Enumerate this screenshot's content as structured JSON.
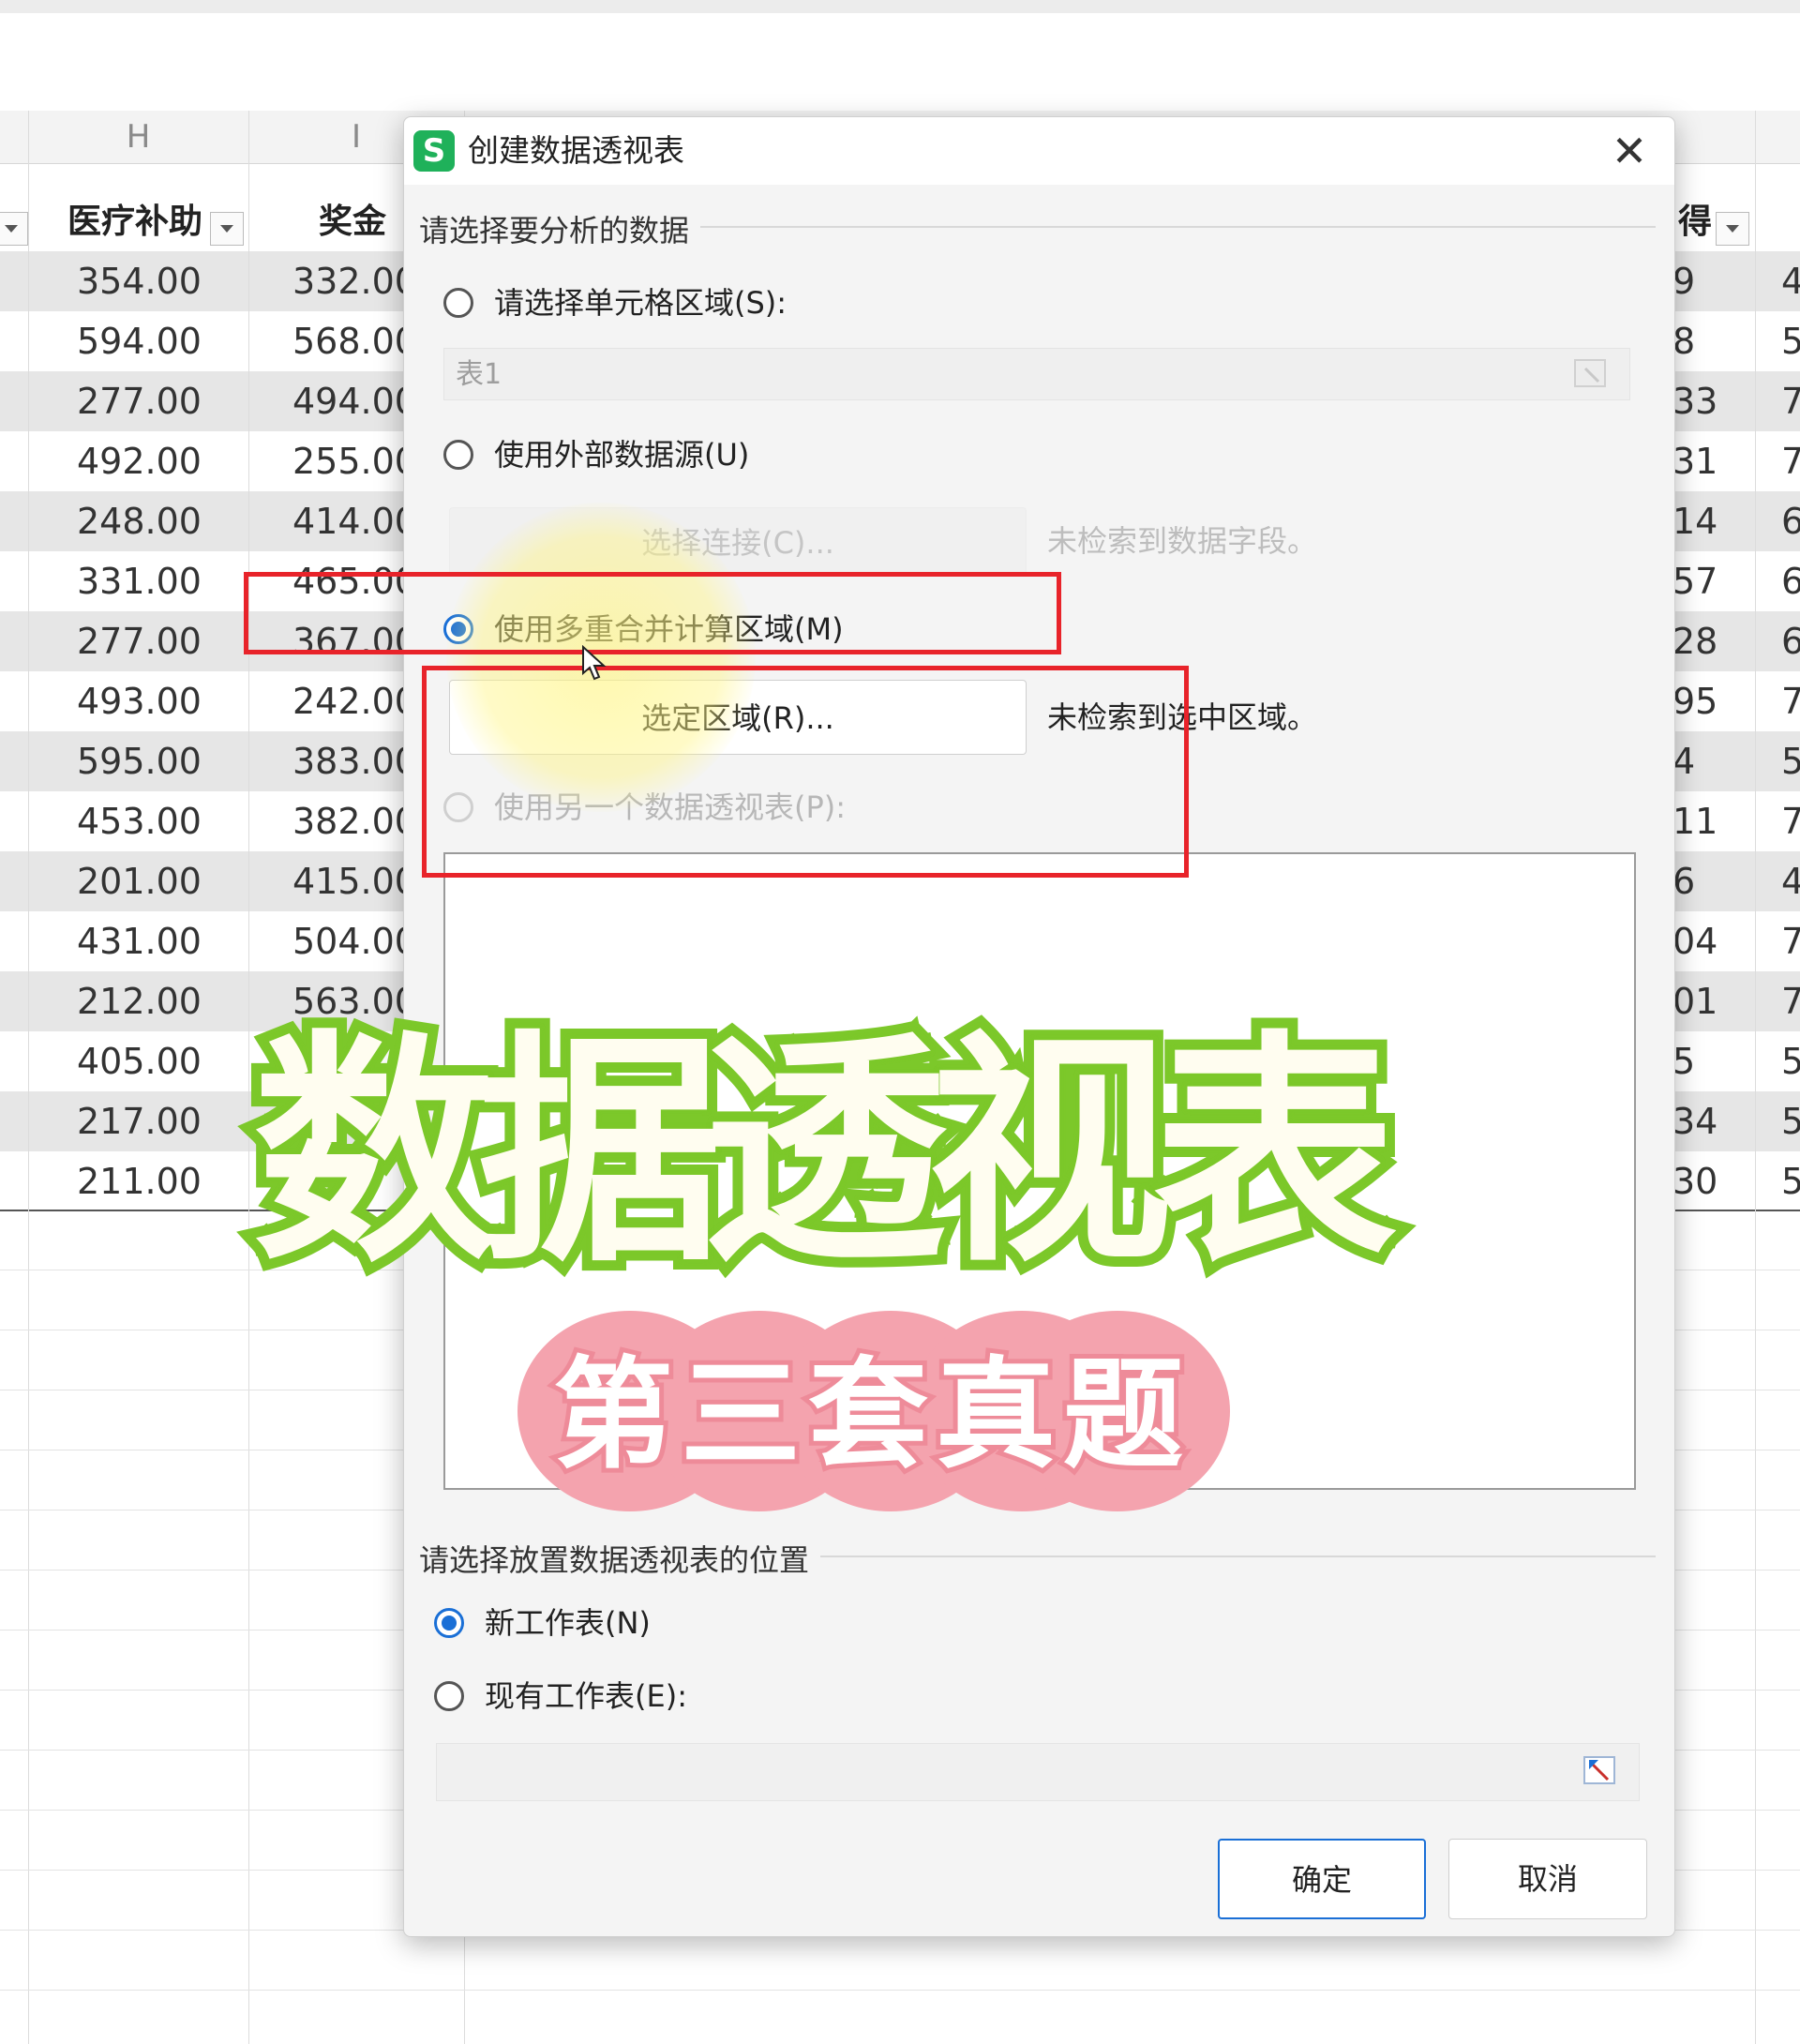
{
  "sheet": {
    "column_letters": [
      "H",
      "I"
    ],
    "fields": [
      "医疗补助",
      "奖金"
    ],
    "right_field_partial": "得",
    "rows": [
      {
        "h": "354.00",
        "i": "332.00",
        "r": "9"
      },
      {
        "h": "594.00",
        "i": "568.00",
        "r": "8"
      },
      {
        "h": "277.00",
        "i": "494.00",
        "r": "33"
      },
      {
        "h": "492.00",
        "i": "255.00",
        "r": "31"
      },
      {
        "h": "248.00",
        "i": "414.00",
        "r": "14"
      },
      {
        "h": "331.00",
        "i": "465.00",
        "r": "57"
      },
      {
        "h": "277.00",
        "i": "367.00",
        "r": "28"
      },
      {
        "h": "493.00",
        "i": "242.00",
        "r": "95"
      },
      {
        "h": "595.00",
        "i": "383.00",
        "r": "4"
      },
      {
        "h": "453.00",
        "i": "382.00",
        "r": "11"
      },
      {
        "h": "201.00",
        "i": "415.00",
        "r": "6"
      },
      {
        "h": "431.00",
        "i": "504.00",
        "r": "04"
      },
      {
        "h": "212.00",
        "i": "563.00",
        "r": "01"
      },
      {
        "h": "405.00",
        "i": "",
        "r": "5"
      },
      {
        "h": "217.00",
        "i": "",
        "r": "34"
      },
      {
        "h": "211.00",
        "i": "",
        "r": "30"
      }
    ],
    "far_right_digits": [
      "4",
      "5",
      "7",
      "7",
      "6",
      "6",
      "6",
      "7",
      "5",
      "7",
      "4",
      "7",
      "7",
      "5",
      "5",
      "5"
    ]
  },
  "dialog": {
    "title": "创建数据透视表",
    "close_symbol": "✕",
    "app_icon_letter": "S",
    "section1_label": "请选择要分析的数据",
    "option_cell_range": "请选择单元格区域(S):",
    "cell_range_value": "表1",
    "option_external": "使用外部数据源(U)",
    "select_connection_button": "选择连接(C)...",
    "no_fields_hint": "未检索到数据字段。",
    "option_multi_range": "使用多重合并计算区域(M)",
    "select_range_button": "选定区域(R)...",
    "no_selection_hint": "未检索到选中区域。",
    "option_other_pivot": "使用另一个数据透视表(P):",
    "section2_label": "请选择放置数据透视表的位置",
    "option_new_sheet": "新工作表(N)",
    "option_existing_sheet": "现有工作表(E):",
    "ok_button": "确定",
    "cancel_button": "取消"
  },
  "overlay": {
    "title": "数据透视表",
    "subtitle": "第三套真题"
  },
  "colors": {
    "accent": "#1a6fd6",
    "red_box": "#e8232a",
    "title_outline": "#7cc82a",
    "pill": "#f4a3ae"
  }
}
